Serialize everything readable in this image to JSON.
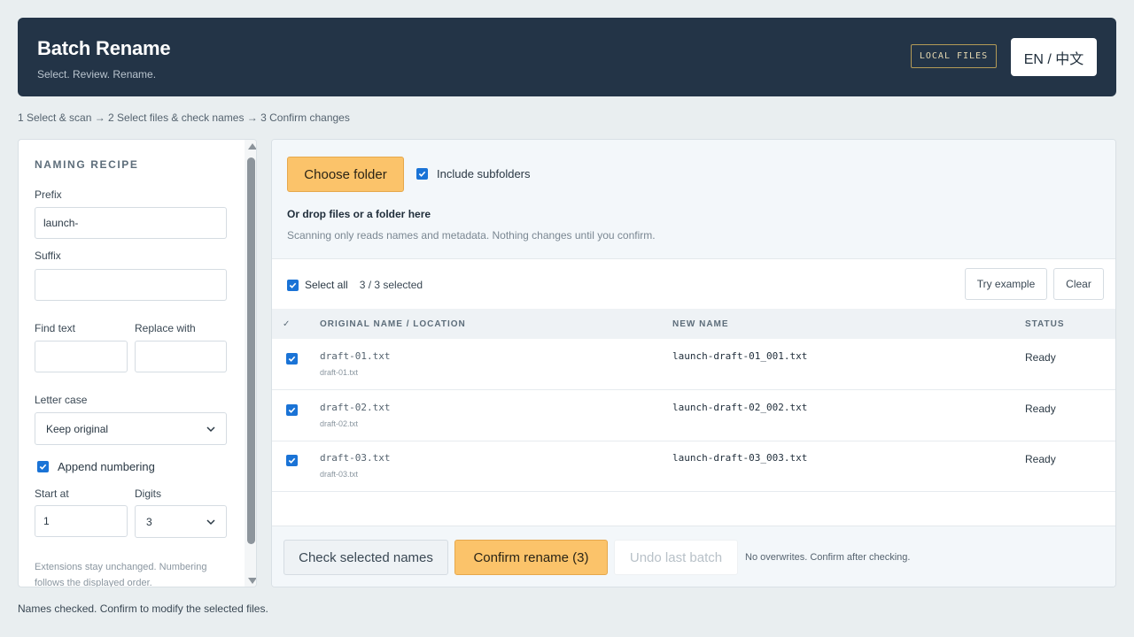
{
  "header": {
    "title": "Batch Rename",
    "subtitle": "Select. Review. Rename.",
    "badge": "LOCAL FILES",
    "lang_toggle": "EN / 中文"
  },
  "steps": "1 Select & scan → 2 Select files & check names → 3 Confirm changes",
  "sidebar": {
    "title": "NAMING RECIPE",
    "prefix_label": "Prefix",
    "prefix_value": "launch-",
    "suffix_label": "Suffix",
    "suffix_value": "",
    "find_label": "Find text",
    "find_value": "",
    "replace_label": "Replace with",
    "replace_value": "",
    "case_label": "Letter case",
    "case_value": "Keep original",
    "append_numbering_label": "Append numbering",
    "append_numbering_checked": true,
    "start_label": "Start at",
    "start_value": "1",
    "digits_label": "Digits",
    "digits_value": "3",
    "note": "Extensions stay unchanged. Numbering follows the displayed order."
  },
  "dropzone": {
    "choose_label": "Choose folder",
    "include_subfolders_label": "Include subfolders",
    "include_subfolders_checked": true,
    "title": "Or drop files or a folder here",
    "desc": "Scanning only reads names and metadata. Nothing changes until you confirm."
  },
  "selection": {
    "select_all_label": "Select all",
    "count": "3 / 3 selected",
    "try_example_label": "Try example",
    "clear_label": "Clear"
  },
  "table": {
    "headers": {
      "check": "✓",
      "original": "ORIGINAL NAME / LOCATION",
      "new": "NEW NAME",
      "status": "STATUS"
    },
    "rows": [
      {
        "original": "draft-01.txt",
        "location": "draft-01.txt",
        "new": "launch-draft-01_001.txt",
        "status": "Ready"
      },
      {
        "original": "draft-02.txt",
        "location": "draft-02.txt",
        "new": "launch-draft-02_002.txt",
        "status": "Ready"
      },
      {
        "original": "draft-03.txt",
        "location": "draft-03.txt",
        "new": "launch-draft-03_003.txt",
        "status": "Ready"
      }
    ]
  },
  "footer": {
    "check_label": "Check selected names",
    "confirm_label": "Confirm rename (3)",
    "undo_label": "Undo last batch",
    "note": "No overwrites. Confirm after checking."
  },
  "status_line": "Names checked. Confirm to modify the selected files.",
  "colors": {
    "header_bg": "#233447",
    "accent": "#fbc36a",
    "checkbox": "#1a73d6",
    "page_bg": "#e9eef0"
  }
}
